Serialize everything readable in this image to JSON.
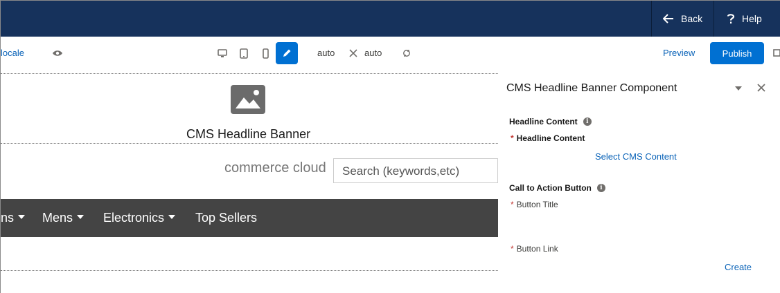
{
  "header": {
    "back_label": "Back",
    "help_label": "Help"
  },
  "toolbar": {
    "locale_label": "locale",
    "width_value": "auto",
    "height_value": "auto",
    "preview_label": "Preview",
    "publish_label": "Publish"
  },
  "canvas": {
    "banner_title": "CMS Headline Banner",
    "brand_text": "commerce cloud",
    "search_placeholder": "Search (keywords,etc)",
    "nav_items": [
      "ns",
      "Mens",
      "Electronics",
      "Top Sellers"
    ]
  },
  "panel": {
    "title": "CMS Headline Banner Component",
    "headline_section": "Headline Content",
    "headline_field": "Headline Content",
    "select_cms_link": "Select CMS Content",
    "cta_section": "Call to Action Button",
    "button_title_field": "Button Title",
    "button_link_field": "Button Link",
    "create_link": "Create",
    "required_marker": "*",
    "info_glyph": "i"
  },
  "colors": {
    "header_bg": "#16325c",
    "brand_blue": "#0070d2",
    "link_blue": "#0a63b8",
    "nav_bg": "#444444"
  }
}
